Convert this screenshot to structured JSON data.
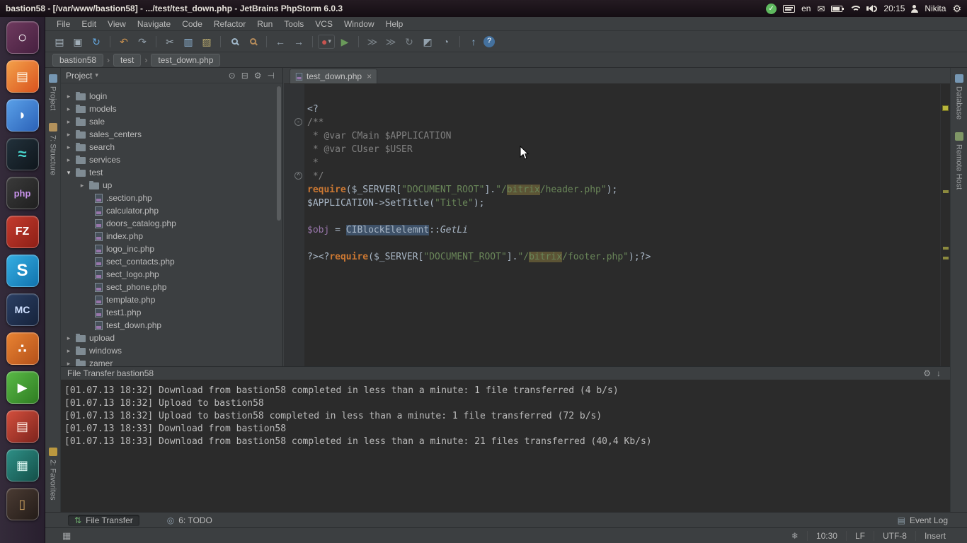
{
  "icons": {
    "check": "✓",
    "mail": "✉",
    "gear": "⚙",
    "close": "×",
    "chevron": "›",
    "dropdown": "▾",
    "grid": "▦",
    "fold_open": "-",
    "fold_end": "^"
  },
  "ubuntu": {
    "title": "bastion58 - [/var/www/bastion58] - .../test/test_down.php - JetBrains PhpStorm 6.0.3",
    "lang": "en",
    "time": "20:15",
    "user": "Nikita"
  },
  "launcher": [
    {
      "name": "dash-home",
      "bg": "linear-gradient(135deg,#6e3a5e,#472040)",
      "glyph": "○",
      "fg": "#ffffff",
      "size": 22
    },
    {
      "name": "file-manager",
      "bg": "linear-gradient(135deg,#f4a14a,#d9531e)",
      "glyph": "▤",
      "fg": "#fff3e0",
      "size": 18
    },
    {
      "name": "browser",
      "bg": "linear-gradient(135deg,#5aa0e8,#2b62b8)",
      "glyph": "◗",
      "fg": "#ffffff",
      "size": 20
    },
    {
      "name": "messenger-wave",
      "bg": "linear-gradient(135deg,#22313b,#0f161c)",
      "glyph": "≈",
      "fg": "#49d8d0",
      "size": 22
    },
    {
      "name": "phpstorm",
      "bg": "linear-gradient(135deg,#3a3a3a,#1f1f1f)",
      "glyph": "php",
      "fg": "#c792ea",
      "size": 13
    },
    {
      "name": "filezilla",
      "bg": "linear-gradient(135deg,#c33b2e,#8e1f16)",
      "glyph": "FZ",
      "fg": "#ffffff",
      "size": 16
    },
    {
      "name": "skype",
      "bg": "linear-gradient(135deg,#35aee3,#1173ad)",
      "glyph": "S",
      "fg": "#ffffff",
      "size": 24
    },
    {
      "name": "midnight-commander",
      "bg": "linear-gradient(135deg,#2b3f63,#16233c)",
      "glyph": "MC",
      "fg": "#cfe0ff",
      "size": 14
    },
    {
      "name": "orange-app",
      "bg": "linear-gradient(135deg,#e98332,#b4511a)",
      "glyph": "∴",
      "fg": "#ffffff",
      "size": 18
    },
    {
      "name": "media-player",
      "bg": "linear-gradient(135deg,#59b946,#2f7d22)",
      "glyph": "▶",
      "fg": "#ffffff",
      "size": 18
    },
    {
      "name": "red-stack-app",
      "bg": "linear-gradient(135deg,#d34f3d,#7e241d)",
      "glyph": "▤",
      "fg": "#ffe9e0",
      "size": 18
    },
    {
      "name": "workspace-stack",
      "bg": "linear-gradient(135deg,#2e8f86,#145049)",
      "glyph": "▦",
      "fg": "#d8f4ef",
      "size": 18
    },
    {
      "name": "trash",
      "bg": "linear-gradient(135deg,#4a3b33,#241c18)",
      "glyph": "▯",
      "fg": "#caa05f",
      "size": 18
    }
  ],
  "menu": [
    "File",
    "Edit",
    "View",
    "Navigate",
    "Code",
    "Refactor",
    "Run",
    "Tools",
    "VCS",
    "Window",
    "Help"
  ],
  "toolbar": [
    {
      "name": "open-icon",
      "glyph": "▤",
      "color": "#a1aeb8"
    },
    {
      "name": "save-all-icon",
      "glyph": "▣",
      "color": "#a1aeb8"
    },
    {
      "name": "synchronize-icon",
      "glyph": "↻",
      "color": "#64a8e0"
    },
    {
      "sep": true
    },
    {
      "name": "undo-icon",
      "glyph": "↶",
      "color": "#cf9450"
    },
    {
      "name": "redo-icon",
      "glyph": "↷",
      "color": "#93a1ad"
    },
    {
      "sep": true
    },
    {
      "name": "cut-icon",
      "glyph": "✂",
      "color": "#a1aeb8"
    },
    {
      "name": "copy-icon",
      "glyph": "▥",
      "color": "#8fb6d8"
    },
    {
      "name": "paste-icon",
      "glyph": "▨",
      "color": "#b7a86e"
    },
    {
      "sep": true
    },
    {
      "name": "find-icon",
      "type": "mag"
    },
    {
      "name": "replace-icon",
      "type": "mag-replace"
    },
    {
      "sep": true
    },
    {
      "name": "back-icon",
      "glyph": "←",
      "color": "#93a1ad"
    },
    {
      "name": "forward-icon",
      "glyph": "→",
      "color": "#93a1ad"
    },
    {
      "sep": true
    },
    {
      "name": "run-config-dropdown",
      "glyph": "●",
      "color": "#c75450",
      "glyph2": "▾",
      "color2": "#9da2a6",
      "box": true
    },
    {
      "name": "run-icon",
      "glyph": "▶",
      "color": "#6a9a5a"
    },
    {
      "sep": true
    },
    {
      "name": "step-over-icon",
      "glyph": "≫",
      "color": "#7a8288"
    },
    {
      "name": "step-into-icon",
      "glyph": "≫",
      "color": "#7a8288"
    },
    {
      "name": "rerun-icon",
      "glyph": "↻",
      "color": "#7a8288"
    },
    {
      "name": "coverage-icon",
      "glyph": "◩",
      "color": "#93a1ad"
    },
    {
      "name": "profiler-icon",
      "glyph": "◔",
      "color": "#93a1ad"
    },
    {
      "sep": true
    },
    {
      "name": "export-icon",
      "glyph": "↑",
      "color": "#8fb6d8"
    },
    {
      "name": "help-icon",
      "glyph": "?",
      "help": true
    }
  ],
  "breadcrumbs": [
    "bastion58",
    "test",
    "test_down.php"
  ],
  "stripes": {
    "left": [
      {
        "name": "toolwindow-project",
        "label": "Project",
        "icon_color": "#7ca1c0"
      },
      {
        "name": "toolwindow-structure",
        "label": "7: Structure",
        "icon_color": "#c09b5f"
      }
    ],
    "left_bottom": [
      {
        "name": "toolwindow-favorites",
        "label": "2: Favorites",
        "icon_color": "#c9a23f"
      }
    ],
    "right": [
      {
        "name": "toolwindow-database",
        "label": "Database",
        "icon_color": "#7ca1c0"
      },
      {
        "name": "toolwindow-remote-host",
        "label": "Remote Host",
        "icon_color": "#86a06a"
      }
    ]
  },
  "project": {
    "header": "Project",
    "header_icons": [
      {
        "name": "locate-icon",
        "glyph": "⊙"
      },
      {
        "name": "collapse-all-icon",
        "glyph": "⊟"
      },
      {
        "name": "settings-icon",
        "glyph": "⚙"
      },
      {
        "name": "hide-panel-icon",
        "glyph": "⊣"
      }
    ],
    "tree": [
      {
        "label": "login",
        "type": "folder",
        "depth": 1,
        "state": "collapsed"
      },
      {
        "label": "models",
        "type": "folder",
        "depth": 1,
        "state": "collapsed"
      },
      {
        "label": "sale",
        "type": "folder",
        "depth": 1,
        "state": "collapsed"
      },
      {
        "label": "sales_centers",
        "type": "folder",
        "depth": 1,
        "state": "collapsed"
      },
      {
        "label": "search",
        "type": "folder",
        "depth": 1,
        "state": "collapsed"
      },
      {
        "label": "services",
        "type": "folder",
        "depth": 1,
        "state": "collapsed"
      },
      {
        "label": "test",
        "type": "folder",
        "depth": 1,
        "state": "expanded"
      },
      {
        "label": "up",
        "type": "folder",
        "depth": 2,
        "state": "collapsed"
      },
      {
        "label": ".section.php",
        "type": "php",
        "depth": 2,
        "leaf": true
      },
      {
        "label": "calculator.php",
        "type": "php",
        "depth": 2,
        "leaf": true
      },
      {
        "label": "doors_catalog.php",
        "type": "php",
        "depth": 2,
        "leaf": true
      },
      {
        "label": "index.php",
        "type": "php",
        "depth": 2,
        "leaf": true
      },
      {
        "label": "logo_inc.php",
        "type": "php",
        "depth": 2,
        "leaf": true
      },
      {
        "label": "sect_contacts.php",
        "type": "php",
        "depth": 2,
        "leaf": true
      },
      {
        "label": "sect_logo.php",
        "type": "php",
        "depth": 2,
        "leaf": true
      },
      {
        "label": "sect_phone.php",
        "type": "php",
        "depth": 2,
        "leaf": true
      },
      {
        "label": "template.php",
        "type": "php",
        "depth": 2,
        "leaf": true
      },
      {
        "label": "test1.php",
        "type": "php",
        "depth": 2,
        "leaf": true
      },
      {
        "label": "test_down.php",
        "type": "php",
        "depth": 2,
        "leaf": true
      },
      {
        "label": "upload",
        "type": "folder",
        "depth": 1,
        "state": "collapsed"
      },
      {
        "label": "windows",
        "type": "folder",
        "depth": 1,
        "state": "collapsed"
      },
      {
        "label": "zamer",
        "type": "folder",
        "depth": 1,
        "state": "collapsed"
      }
    ]
  },
  "editor": {
    "tab": "test_down.php",
    "lines": [
      {
        "seg": [
          {
            "t": "<?",
            "c": "tag"
          }
        ]
      },
      {
        "fold": "minus",
        "seg": [
          {
            "t": "/**",
            "c": "doc"
          }
        ]
      },
      {
        "seg": [
          {
            "t": " * @var CMain $APPLICATION",
            "c": "doc"
          }
        ]
      },
      {
        "seg": [
          {
            "t": " * @var CUser $USER",
            "c": "doc"
          }
        ]
      },
      {
        "seg": [
          {
            "t": " *",
            "c": "doc"
          }
        ]
      },
      {
        "fold": "end",
        "seg": [
          {
            "t": " */",
            "c": "doc"
          }
        ]
      },
      {
        "seg": [
          {
            "t": "require",
            "c": "kw"
          },
          {
            "t": "(",
            "c": "plain"
          },
          {
            "t": "$_SERVER",
            "c": "plain"
          },
          {
            "t": "[",
            "c": "plain"
          },
          {
            "t": "\"DOCUMENT_ROOT\"",
            "c": "str"
          },
          {
            "t": "].",
            "c": "plain"
          },
          {
            "t": "\"/",
            "c": "str"
          },
          {
            "t": "bitrix",
            "c": "str hl"
          },
          {
            "t": "/header.php\"",
            "c": "str"
          },
          {
            "t": ");",
            "c": "plain"
          }
        ]
      },
      {
        "seg": [
          {
            "t": "$APPLICATION",
            "c": "plain"
          },
          {
            "t": "->",
            "c": "plain"
          },
          {
            "t": "SetTitle",
            "c": "plain"
          },
          {
            "t": "(",
            "c": "plain"
          },
          {
            "t": "\"Title\"",
            "c": "str"
          },
          {
            "t": ");",
            "c": "plain"
          }
        ]
      },
      {
        "seg": []
      },
      {
        "seg": [
          {
            "t": "$obj",
            "c": "var2"
          },
          {
            "t": " = ",
            "c": "plain"
          },
          {
            "t": "CIBlockElelemnt",
            "c": "plain sel"
          },
          {
            "t": "::",
            "c": "plain"
          },
          {
            "t": "GetLi",
            "c": "method"
          }
        ]
      },
      {
        "seg": []
      },
      {
        "seg": [
          {
            "t": "?>",
            "c": "tag"
          },
          {
            "t": "<?",
            "c": "tag"
          },
          {
            "t": "require",
            "c": "kw"
          },
          {
            "t": "(",
            "c": "plain"
          },
          {
            "t": "$_SERVER",
            "c": "plain"
          },
          {
            "t": "[",
            "c": "plain"
          },
          {
            "t": "\"DOCUMENT_ROOT\"",
            "c": "str"
          },
          {
            "t": "].",
            "c": "plain"
          },
          {
            "t": "\"/",
            "c": "str"
          },
          {
            "t": "bitrix",
            "c": "str hl"
          },
          {
            "t": "/footer.php\"",
            "c": "str"
          },
          {
            "t": ");",
            "c": "plain"
          },
          {
            "t": "?>",
            "c": "tag"
          }
        ]
      }
    ]
  },
  "file_transfer": {
    "title": "File Transfer bastion58",
    "header_icons": [
      {
        "name": "settings-icon",
        "glyph": "⚙"
      },
      {
        "name": "scroll-to-end-icon",
        "glyph": "↓"
      }
    ],
    "log": [
      "[01.07.13 18:32] Download from bastion58 completed in less than a minute: 1 file transferred (4 b/s)",
      "[01.07.13 18:32] Upload to bastion58",
      "[01.07.13 18:32] Upload to bastion58 completed in less than a minute: 1 file transferred (72 b/s)",
      "[01.07.13 18:33] Download from bastion58",
      "[01.07.13 18:33] Download from bastion58 completed in less than a minute: 21 files transferred (40,4 Kb/s)"
    ]
  },
  "bottom_buttons": [
    {
      "name": "toolwindow-button-file-transfer",
      "label": "File Transfer",
      "icon": "⇅",
      "icon_color": "#6fae6f",
      "active": true
    },
    {
      "name": "toolwindow-button-todo",
      "label": "6: TODO",
      "icon": "◎",
      "icon_color": "#8c9ba8",
      "active": false
    }
  ],
  "event_log": {
    "label": "Event Log",
    "icon": "▤"
  },
  "status": {
    "items": [
      {
        "name": "hector-icon",
        "text": "❄"
      },
      {
        "name": "caret-position",
        "text": "10:30"
      },
      {
        "name": "line-separator",
        "text": "LF"
      },
      {
        "name": "encoding",
        "text": "UTF-8"
      },
      {
        "name": "insert-mode",
        "text": "Insert"
      }
    ]
  }
}
